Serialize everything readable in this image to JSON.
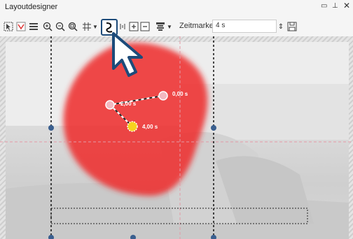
{
  "window": {
    "title": "Layoutdesigner"
  },
  "toolbar": {
    "timestamp_label": "Zeitmarke:",
    "timestamp_value": "4 s"
  },
  "path": {
    "points": [
      {
        "label": "0,00 s"
      },
      {
        "label": "2,00 s"
      },
      {
        "label": "4,00 s"
      }
    ]
  },
  "colors": {
    "blob": "#ee2a2a",
    "handle": "#3a5f8f",
    "highlight_border": "#1d4b7a"
  }
}
